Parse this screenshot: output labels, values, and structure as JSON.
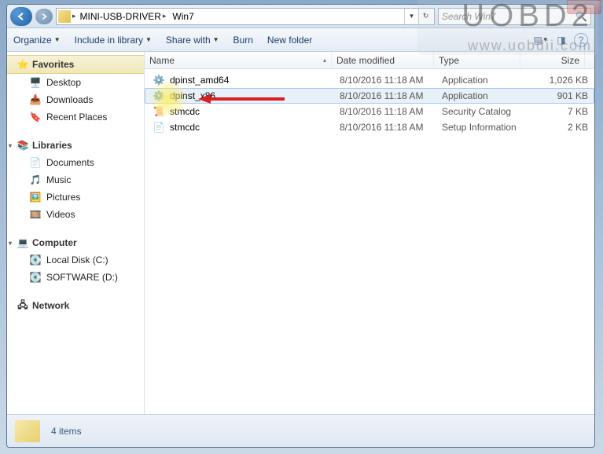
{
  "breadcrumb": {
    "seg1": "MINI-USB-DRIVER",
    "seg2": "Win7"
  },
  "search": {
    "placeholder": "Search Win7"
  },
  "toolbar": {
    "organize": "Organize",
    "include": "Include in library",
    "share": "Share with",
    "burn": "Burn",
    "newfolder": "New folder"
  },
  "nav": {
    "favorites": "Favorites",
    "desktop": "Desktop",
    "downloads": "Downloads",
    "recent": "Recent Places",
    "libraries": "Libraries",
    "documents": "Documents",
    "music": "Music",
    "pictures": "Pictures",
    "videos": "Videos",
    "computer": "Computer",
    "localc": "Local Disk (C:)",
    "softd": "SOFTWARE (D:)",
    "network": "Network"
  },
  "columns": {
    "name": "Name",
    "date": "Date modified",
    "type": "Type",
    "size": "Size"
  },
  "files": [
    {
      "name": "dpinst_amd64",
      "date": "8/10/2016 11:18 AM",
      "type": "Application",
      "size": "1,026 KB",
      "icon": "exe"
    },
    {
      "name": "dpinst_x86",
      "date": "8/10/2016 11:18 AM",
      "type": "Application",
      "size": "901 KB",
      "icon": "exe",
      "selected": true
    },
    {
      "name": "stmcdc",
      "date": "8/10/2016 11:18 AM",
      "type": "Security Catalog",
      "size": "7 KB",
      "icon": "cat"
    },
    {
      "name": "stmcdc",
      "date": "8/10/2016 11:18 AM",
      "type": "Setup Information",
      "size": "2 KB",
      "icon": "inf"
    }
  ],
  "status": {
    "count": "4 items"
  },
  "watermark": {
    "big": "UOBD2",
    "small": "www.uobdii.com"
  }
}
